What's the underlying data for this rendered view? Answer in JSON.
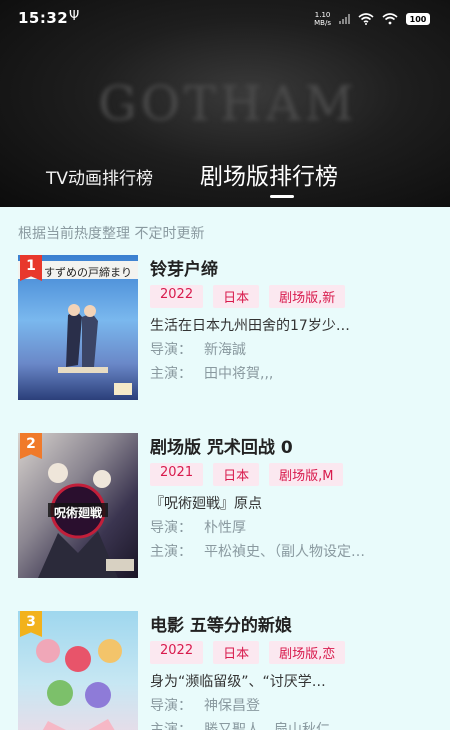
{
  "status_bar": {
    "time": "15:32",
    "usb_glyph": "Ψ",
    "net_speed_value": "1.10",
    "net_speed_unit": "MB/s",
    "battery": "100"
  },
  "banner": {
    "text": "GOTHAM"
  },
  "tabs": [
    {
      "label": "TV动画排行榜",
      "active": false
    },
    {
      "label": "剧场版排行榜",
      "active": true
    }
  ],
  "subtitle": "根据当前热度整理 不定时更新",
  "labels": {
    "director": "导演：",
    "cast": "主演："
  },
  "items": [
    {
      "rank": "1",
      "rank_color": "#e8382c",
      "title": "铃芽户缔",
      "tags": [
        "2022",
        "日本",
        "剧场版,新"
      ],
      "description": "生活在日本九州田舍的17岁少…",
      "director": "新海誠",
      "cast": "田中将賀,,,",
      "poster_caption": "すずめの戸締まり"
    },
    {
      "rank": "2",
      "rank_color": "#f07a2a",
      "title": "剧场版 咒术回战 0",
      "tags": [
        "2021",
        "日本",
        "剧场版,M"
      ],
      "description": "『呪術廻戦』原点",
      "director": "朴性厚",
      "cast": "平松禎史、（副人物设定…",
      "poster_caption": "呪術廻戦"
    },
    {
      "rank": "3",
      "rank_color": "#f2b21c",
      "title": "电影 五等分的新娘",
      "tags": [
        "2022",
        "日本",
        "剧场版,恋"
      ],
      "description": "身为“濒临留级”、“讨厌学…",
      "director": "神保昌登",
      "cast": "勝又聖人、扇山秋仁",
      "poster_caption": ""
    }
  ],
  "colors": {
    "page_bg": "#e9fbfb",
    "tag_bg": "#fbe8f0",
    "tag_text": "#d81b4d",
    "muted_text": "#8a9aa0"
  }
}
